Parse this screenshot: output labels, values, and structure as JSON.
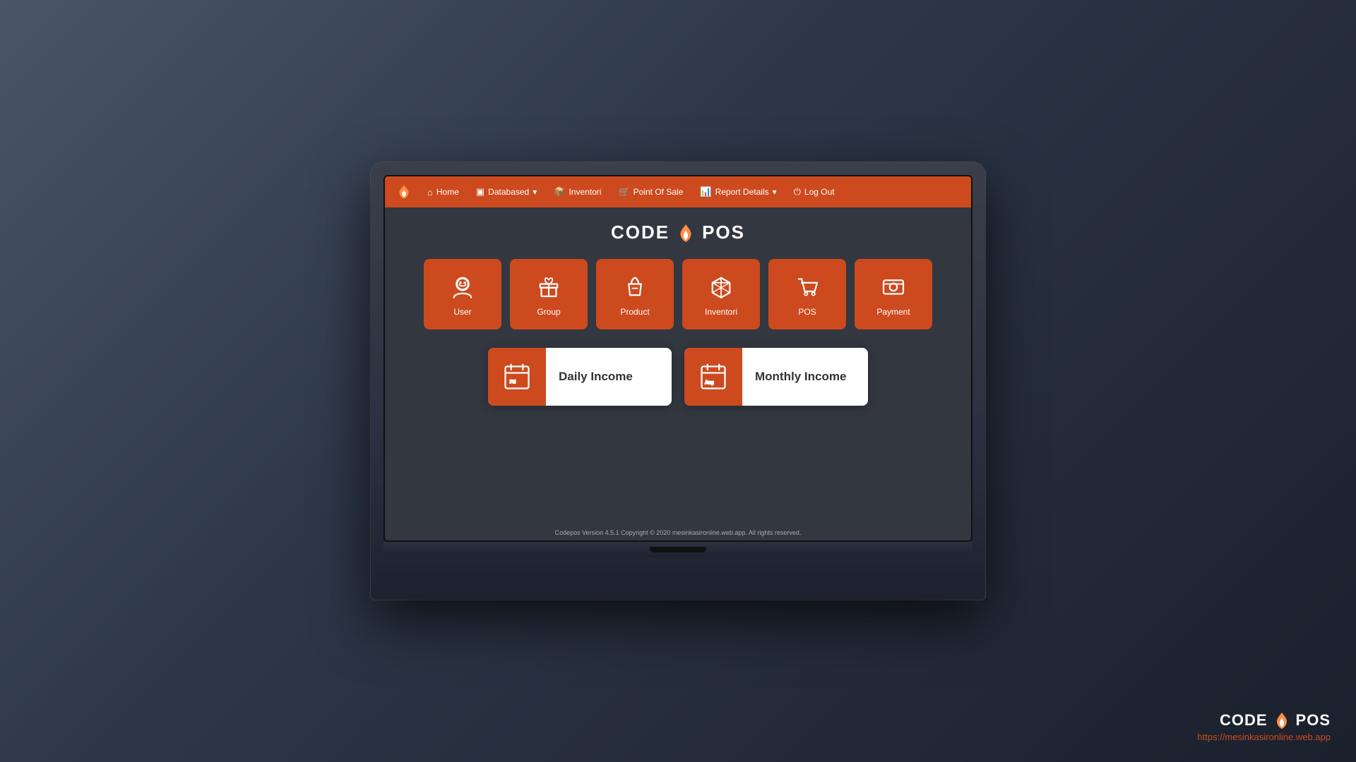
{
  "app": {
    "title_part1": "CODE",
    "title_part2": "POS",
    "flame_icon": "🔥"
  },
  "navbar": {
    "logo_alt": "flame-logo",
    "items": [
      {
        "label": "Home",
        "icon": "home"
      },
      {
        "label": "Databased",
        "icon": "database",
        "dropdown": true
      },
      {
        "label": "Inventori",
        "icon": "box"
      },
      {
        "label": "Point Of Sale",
        "icon": "cart"
      },
      {
        "label": "Report Details",
        "icon": "chart",
        "dropdown": true
      },
      {
        "label": "Log Out",
        "icon": "power"
      }
    ]
  },
  "icon_cards": [
    {
      "label": "User",
      "icon": "smiley"
    },
    {
      "label": "Group",
      "icon": "gift"
    },
    {
      "label": "Product",
      "icon": "bag"
    },
    {
      "label": "Inventori",
      "icon": "cube"
    },
    {
      "label": "POS",
      "icon": "cart"
    },
    {
      "label": "Payment",
      "icon": "payment"
    }
  ],
  "income_cards": [
    {
      "label": "Daily Income",
      "day": "Fri",
      "icon": "calendar-day"
    },
    {
      "label": "Monthly Income",
      "month": "Aug",
      "icon": "calendar-month"
    }
  ],
  "footer": {
    "text": "Codepos Version 4.5.1 Copyright © 2020 mesinkasironline.web.app. All rights reserved."
  },
  "watermark": {
    "title_part1": "CODE",
    "title_part2": "POS",
    "url": "https://mesinkasironline.web.app"
  }
}
